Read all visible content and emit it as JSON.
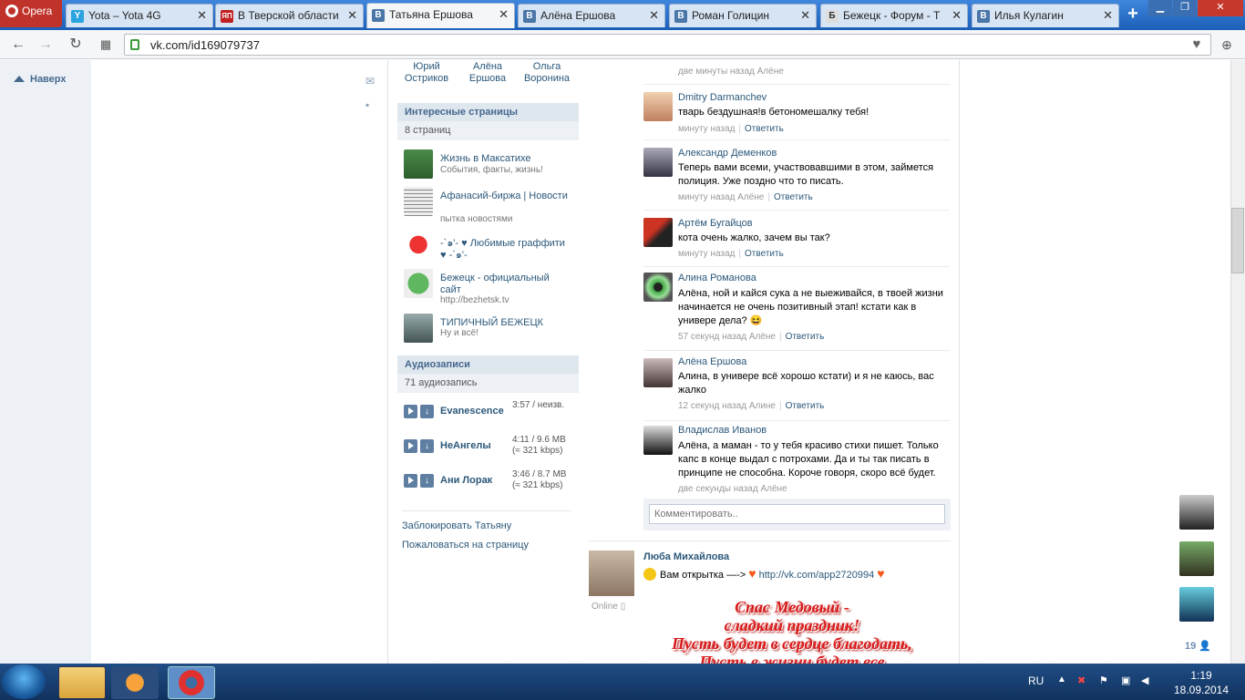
{
  "browser": {
    "menu_label": "Opera",
    "tabs": [
      {
        "title": "Yota – Yota 4G",
        "icon": "Y",
        "active": false
      },
      {
        "title": "В Тверской области",
        "icon": "ЯП",
        "active": false
      },
      {
        "title": "Татьяна Ершова",
        "icon": "В",
        "active": true
      },
      {
        "title": "Алёна Ершова",
        "icon": "В",
        "active": false
      },
      {
        "title": "Роман Голицин",
        "icon": "В",
        "active": false
      },
      {
        "title": "Бежецк - Форум - Т",
        "icon": "Б",
        "active": false
      },
      {
        "title": "Илья Кулагин",
        "icon": "В",
        "active": false
      }
    ],
    "close_glyph": "✕",
    "new_tab": "+",
    "url": "vk.com/id169079737"
  },
  "page": {
    "up_label": "Наверх",
    "friends_top": [
      {
        "name": "Юрий Остриков"
      },
      {
        "name": "Алёна Ершова"
      },
      {
        "name": "Ольга Воронина"
      }
    ],
    "interesting": {
      "title": "Интересные страницы",
      "count": "8 страниц",
      "items": [
        {
          "name": "Жизнь в Максатихе",
          "desc": "События, факты, жизнь!"
        },
        {
          "name": "Афанасий-биржа | Новости",
          "desc": "пытка новостями"
        },
        {
          "name": "-`๑'- ♥ Любимые граффити ♥ -`๑'-",
          "desc": ""
        },
        {
          "name": "Бежецк - официальный сайт",
          "desc": "http://bezhetsk.tv"
        },
        {
          "name": "ТИПИЧНЫЙ БЕЖЕЦК",
          "desc": "Ну и всё!"
        }
      ]
    },
    "audio": {
      "title": "Аудиозаписи",
      "count": "71 аудиозапись",
      "tracks": [
        {
          "artist": "Evanescence",
          "meta1": "3:57 / неизв.",
          "meta2": ""
        },
        {
          "artist": "НеАнгелы",
          "meta1": "4:11 / 9.6 MB",
          "meta2": "(≈ 321 kbps)"
        },
        {
          "artist": "Ани Лорак",
          "meta1": "3:46 / 8.7 MB",
          "meta2": "(≈ 321 kbps)"
        }
      ]
    },
    "links": {
      "block": "Заблокировать Татьяну",
      "report": "Пожаловаться на страницу"
    },
    "reply_label": "Ответить",
    "top_meta": "две минуты назад Алёне",
    "comments": [
      {
        "author": "Dmitry Darmanchev",
        "text": "тварь бездушная!в бетономешалку тебя!",
        "meta": "минуту назад"
      },
      {
        "author": "Александр Деменков",
        "text": "Теперь вами всеми, участвовавшими в этом, займется полиция. Уже поздно что то писать.",
        "meta": "минуту назад Алёне"
      },
      {
        "author": "Артём Бугайцов",
        "text": "кота очень жалко, зачем вы так?",
        "meta": "минуту назад"
      },
      {
        "author": "Алина Романова",
        "text": "Алёна, ной и кайся сука а не выеживайся, в твоей жизни начинается не очень позитивный этап! кстати как в универе дела? 😆",
        "meta": "57 секунд назад Алёне"
      },
      {
        "author": "Алёна Ершова",
        "text": "Алина, в универе всё хорошо кстати) и я не каюсь, вас жалко",
        "meta": "12 секунд назад Алине"
      },
      {
        "author": "Владислав Иванов",
        "text": "Алёна, а маман - то у тебя красиво стихи пишет. Только капс в конце выдал с потрохами. Да и ты так писать в принципе не способна. Короче говоря, скоро всё будет.",
        "meta": "две секунды назад Алёне"
      }
    ],
    "comment_placeholder": "Комментировать..",
    "post": {
      "author": "Люба Михайлова",
      "text_prefix": "Вам открытка —->",
      "link": "http://vk.com/app2720994",
      "online": "Online",
      "card_lines": [
        "Спас Медовый -",
        "сладкий праздник!",
        "Пусть будет в сердце благодать,",
        "Пусть в жизни будет все"
      ]
    },
    "friends_count": "19"
  },
  "taskbar": {
    "lang": "RU",
    "time": "1:19",
    "date": "18.09.2014"
  },
  "colors": {
    "link": "#2b587a",
    "header_bg": "#dee6ee",
    "tabbar": "#1f68c4"
  }
}
